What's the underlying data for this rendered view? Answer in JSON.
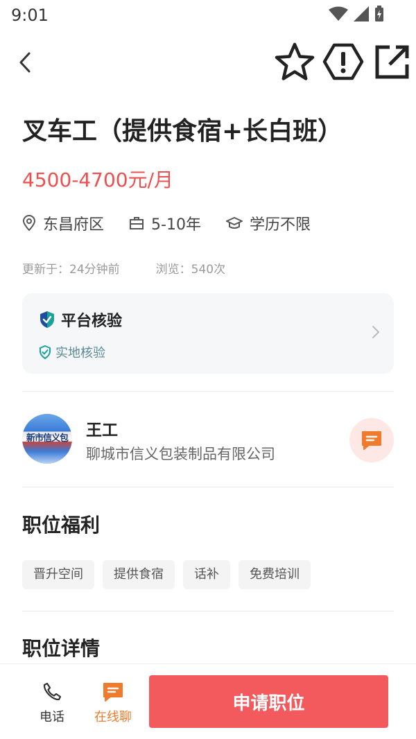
{
  "status_bar": {
    "time": "9:01"
  },
  "job": {
    "title": "叉车工（提供食宿+长白班）",
    "salary": "4500-4700元/月",
    "location": "东昌府区",
    "experience": "5-10年",
    "education": "学历不限",
    "updated": "更新于：24分钟前",
    "views": "浏览：540次"
  },
  "verification": {
    "title": "平台核验",
    "sub": "实地核验"
  },
  "recruiter": {
    "name": "王工",
    "company": "聊城市信义包装制品有限公司",
    "avatar_text": "新市信义包"
  },
  "benefits": {
    "title": "职位福利",
    "tags": [
      "晋升空间",
      "提供食宿",
      "话补",
      "免费培训"
    ]
  },
  "details": {
    "title": "职位详情"
  },
  "bottom": {
    "phone_label": "电话",
    "chat_label": "在线聊",
    "apply_label": "申请职位"
  },
  "colors": {
    "accent_red": "#ef4f4f",
    "apply_button": "#f25a5e",
    "chat_orange": "#f07b2c",
    "verify_teal": "#1aa39a"
  }
}
